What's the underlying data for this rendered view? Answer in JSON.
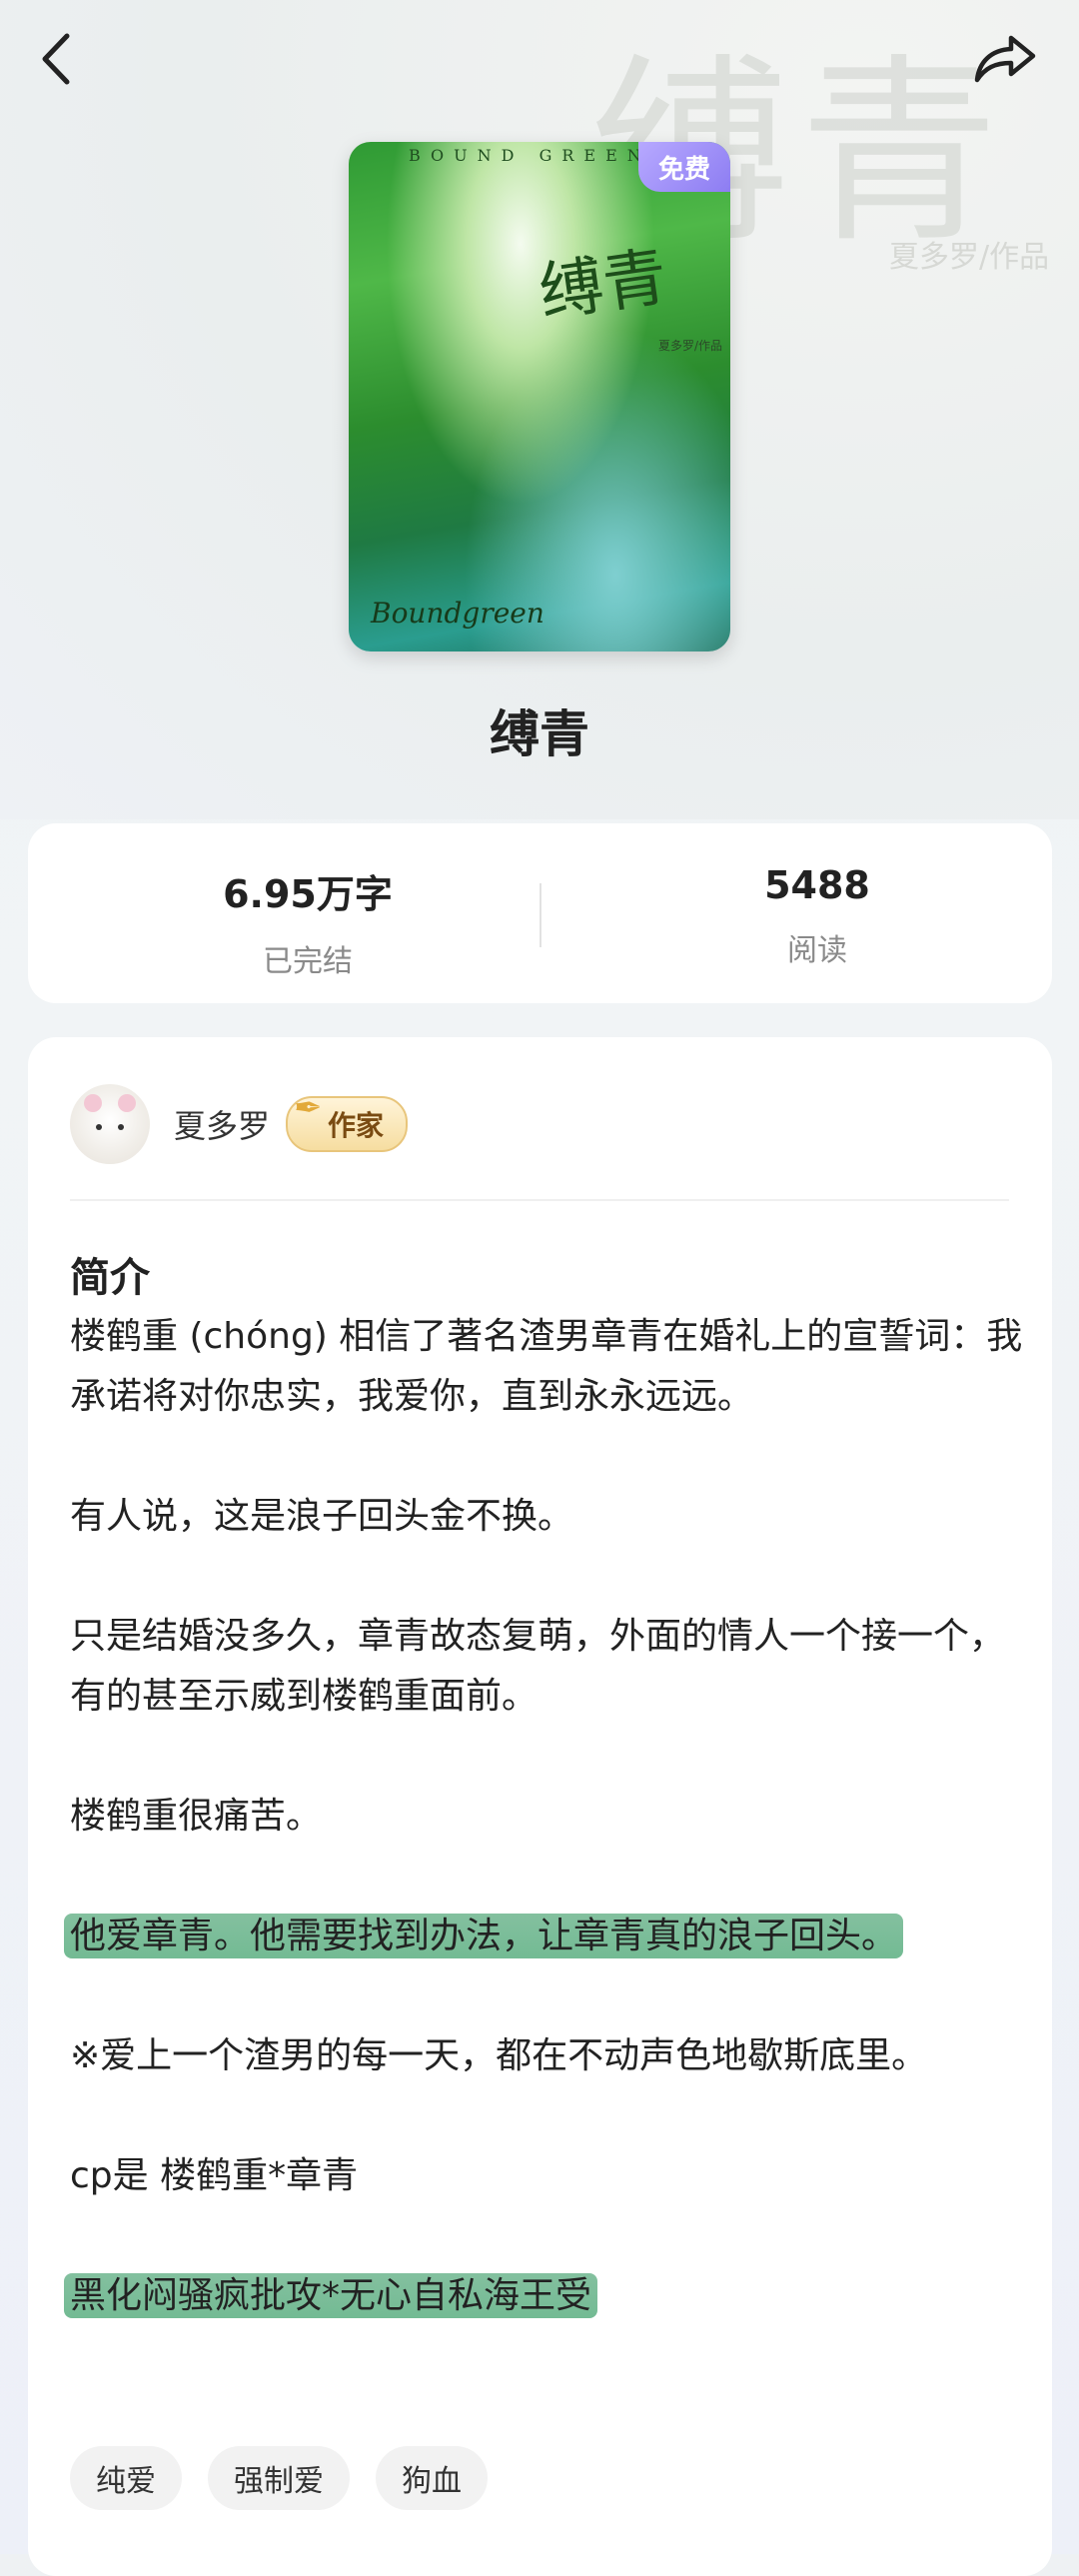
{
  "header": {
    "back_icon": "chevron-left-icon",
    "share_icon": "share-icon"
  },
  "background": {
    "ghost_title": "缚青",
    "ghost_author": "夏多罗/作品"
  },
  "cover": {
    "badge": "免费",
    "top_text": "BOUND GREEN",
    "calligraphy": "缚青",
    "author_mark": "夏多罗/作品",
    "script": "Boundgreen"
  },
  "book": {
    "title": "缚青"
  },
  "stats": {
    "words_value": "6.95万字",
    "words_label": "已完结",
    "reads_value": "5488",
    "reads_label": "阅读"
  },
  "author": {
    "name": "夏多罗",
    "badge": "作家"
  },
  "intro": {
    "heading": "简介",
    "p1": "楼鹤重 (chóng) 相信了著名渣男章青在婚礼上的宣誓词：我承诺将对你忠实，我爱你，直到永永远远。",
    "p2": "有人说，这是浪子回头金不换。",
    "p3": "只是结婚没多久，章青故态复萌，外面的情人一个接一个，有的甚至示威到楼鹤重面前。",
    "p4": "楼鹤重很痛苦。",
    "p5": "他爱章青。他需要找到办法，让章青真的浪子回头。",
    "p6": "※爱上一个渣男的每一天，都在不动声色地歇斯底里。",
    "p7": "cp是 楼鹤重*章青",
    "p8": "黑化闷骚疯批攻*无心自私海王受"
  },
  "tags": [
    "纯爱",
    "强制爱",
    "狗血"
  ],
  "colors": {
    "highlight": "#2e9a5c",
    "badge_purple": "#9a8cf5",
    "card": "#ffffff"
  }
}
